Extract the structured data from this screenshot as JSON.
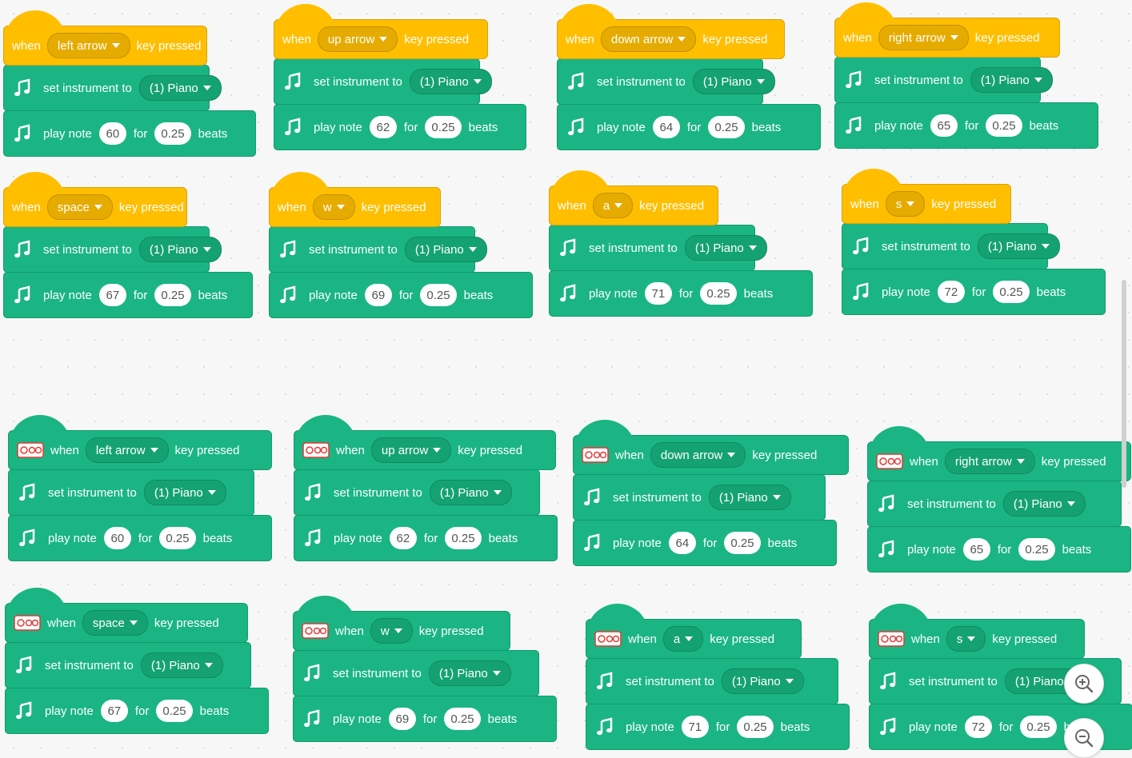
{
  "labels": {
    "when": "when",
    "key_pressed": "key pressed",
    "set_instrument": "set instrument to",
    "play_note": "play note",
    "for": "for",
    "beats": "beats",
    "instrument": "(1) Piano",
    "beats_value": "0.25"
  },
  "colors": {
    "event_hat": "#ffbf00",
    "music_block": "#1ab583"
  },
  "icons": {
    "music": "music-note-icon",
    "extension": "extension-device-icon",
    "zoom_in": "zoom-in-icon",
    "zoom_out": "zoom-out-icon"
  },
  "scripts": [
    {
      "type": "event",
      "key": "left arrow",
      "note": "60"
    },
    {
      "type": "event",
      "key": "up arrow",
      "note": "62"
    },
    {
      "type": "event",
      "key": "down arrow",
      "note": "64"
    },
    {
      "type": "event",
      "key": "right arrow",
      "note": "65"
    },
    {
      "type": "event",
      "key": "space",
      "note": "67"
    },
    {
      "type": "event",
      "key": "w",
      "note": "69"
    },
    {
      "type": "event",
      "key": "a",
      "note": "71"
    },
    {
      "type": "event",
      "key": "s",
      "note": "72"
    },
    {
      "type": "extension",
      "key": "left arrow",
      "note": "60"
    },
    {
      "type": "extension",
      "key": "up arrow",
      "note": "62"
    },
    {
      "type": "extension",
      "key": "down arrow",
      "note": "64"
    },
    {
      "type": "extension",
      "key": "right arrow",
      "note": "65"
    },
    {
      "type": "extension",
      "key": "space",
      "note": "67"
    },
    {
      "type": "extension",
      "key": "w",
      "note": "69"
    },
    {
      "type": "extension",
      "key": "a",
      "note": "71"
    },
    {
      "type": "extension",
      "key": "s",
      "note": "72"
    }
  ]
}
